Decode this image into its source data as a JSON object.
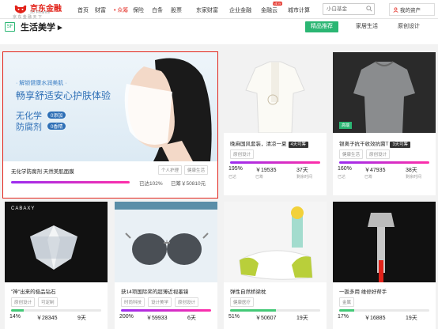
{
  "header": {
    "logo_text": "京东金融",
    "logo_sub": "JD Finance",
    "logo_slogan": "京 东 金 融 天 下",
    "nav": [
      "首页",
      "财富",
      "众筹",
      "保险",
      "白条",
      "股票",
      "东家财富",
      "企业金融",
      "金融云",
      "城市计算"
    ],
    "nav_active": "众筹",
    "new_badge": "NEW",
    "search_placeholder": "小白基金",
    "assets_label": "我的资产"
  },
  "section": {
    "icon_text": "SF",
    "title": "生活美学",
    "tabs": [
      "精品推荐",
      "家居生活",
      "原创设计"
    ]
  },
  "featured": {
    "banner_line1": "· 解锁健康水润美肌 ·",
    "banner_line2": "畅享舒适安心护肤体验",
    "banner_line3": "无化学",
    "banner_line4": "防腐剂",
    "banner_pill1": "0添加",
    "banner_pill2": "0香精",
    "title": "无化学防腐剂 天然美肌面膜",
    "tags": [
      "个人护理",
      "健康生活"
    ],
    "progress": 1.0,
    "pct_label": "已达102%",
    "amount_label": "已筹￥50810元"
  },
  "products": [
    {
      "title": "晚麻国风套装，清凉一夏",
      "days_tag": "4天可筹",
      "tags": [
        "原创设计"
      ],
      "progress": 1.0,
      "pct": "195%",
      "amount": "￥19535",
      "days": "37天",
      "pct_lbl": "已达",
      "amt_lbl": "已筹",
      "day_lbl": "剩余时间",
      "color": "purple"
    },
    {
      "title": "银离子抗干收效抗菌T",
      "days_tag": "3天可筹",
      "tags": [
        "健康生活",
        "原创设计"
      ],
      "badge": "高端",
      "progress": 1.0,
      "pct": "160%",
      "amount": "￥47935",
      "days": "38天",
      "pct_lbl": "已达",
      "amt_lbl": "已筹",
      "day_lbl": "剩余时间",
      "color": "purple"
    },
    {
      "title": "\"神\"出来的极品钻石",
      "tags": [
        "原创设计",
        "可定制"
      ],
      "brand": "CABAXY",
      "progress": 0.14,
      "pct": "14%",
      "amount": "￥28345",
      "days": "9天",
      "color": "green"
    },
    {
      "title": "获14项国际奖的超薄近视墨镜",
      "tags": [
        "时尚科技",
        "设计美学",
        "原创设计"
      ],
      "progress": 1.0,
      "pct": "200%",
      "amount": "￥59933",
      "days": "6天",
      "color": "purple"
    },
    {
      "title": "弹性自然桥梁枕",
      "tags": [
        "健康医疗"
      ],
      "progress": 0.51,
      "pct": "51%",
      "amount": "￥50607",
      "days": "19天",
      "color": "green"
    },
    {
      "title": "一扳多用 维修好帮手",
      "tags": [
        "金属"
      ],
      "progress": 0.17,
      "pct": "17%",
      "amount": "￥16885",
      "days": "19天",
      "color": "green"
    }
  ]
}
